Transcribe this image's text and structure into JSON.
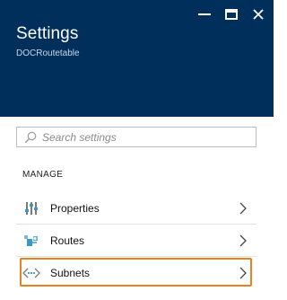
{
  "header": {
    "title": "Settings",
    "subtitle": "DOCRoutetable",
    "background_color": "#002f5c",
    "controls": [
      {
        "icon": "pin-icon"
      },
      {
        "icon": "maximize-icon"
      },
      {
        "icon": "close-icon"
      }
    ]
  },
  "search": {
    "placeholder": "Search settings",
    "value": "",
    "icon": "search-icon"
  },
  "section": {
    "label": "MANAGE"
  },
  "menu": [
    {
      "label": "Properties",
      "icon": "properties-icon"
    },
    {
      "label": "Routes",
      "icon": "routes-icon"
    },
    {
      "label": "Subnets",
      "icon": "subnets-icon",
      "highlighted": true
    }
  ],
  "highlight_color": "#e8821e"
}
